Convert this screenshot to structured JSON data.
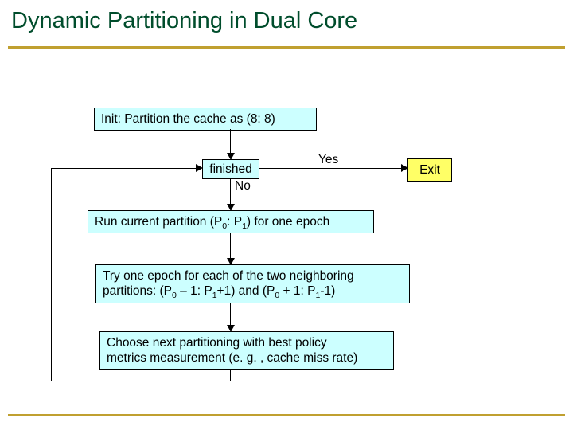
{
  "title": "Dynamic Partitioning in Dual Core",
  "flow": {
    "init": "Init: Partition the cache as (8: 8)",
    "finished": "finished",
    "no": "No",
    "yes": "Yes",
    "exit": "Exit",
    "run_prefix": "Run current partition (P",
    "sub0": "0",
    "run_mid": ": P",
    "sub1": "1",
    "run_suffix": ") for one epoch",
    "try_l1_a": "Try one epoch for each of the two neighboring",
    "try_l2_a": "partitions: (P",
    "try_l2_b": " – 1: P",
    "try_l2_c": "+1) and (P",
    "try_l2_d": " + 1: P",
    "try_l2_e": "-1)",
    "choose_l1": "Choose next partitioning with best policy",
    "choose_l2": "metrics measurement (e. g. , cache miss rate)"
  }
}
